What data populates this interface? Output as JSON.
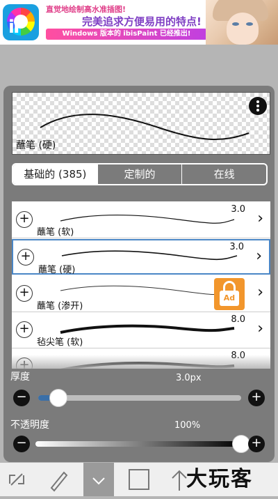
{
  "ad": {
    "line1": "直觉地绘制高水准插图!",
    "line2": "完美追求方便易用的特点!",
    "line3": "Windows 版本的 ibisPaint 已经推出!",
    "logo_text": "iP"
  },
  "preview": {
    "brush_name": "蘸笔 (硬)"
  },
  "tabs": [
    {
      "label": "基础的 (385)",
      "active": true
    },
    {
      "label": "定制的",
      "active": false
    },
    {
      "label": "在线",
      "active": false
    }
  ],
  "brushes": [
    {
      "name": "蘸笔 (软)",
      "size": "3.0",
      "selected": false,
      "locked": false
    },
    {
      "name": "蘸笔 (硬)",
      "size": "3.0",
      "selected": true,
      "locked": false
    },
    {
      "name": "蘸笔 (渗开)",
      "size": "",
      "selected": false,
      "locked": true,
      "lock_label": "Ad"
    },
    {
      "name": "毡尖笔 (软)",
      "size": "8.0",
      "selected": false,
      "locked": false
    },
    {
      "name": "",
      "size": "8.0",
      "selected": false,
      "locked": false
    }
  ],
  "thickness": {
    "label": "厚度",
    "value": "3.0px",
    "level": 0.1
  },
  "opacity": {
    "label": "不透明度",
    "value": "100%",
    "level": 1.0
  },
  "watermark": "大玩客",
  "colors": {
    "selection": "#4a86c6",
    "ad_lock": "#f2962c",
    "slider_fill": "#3a6fa8"
  }
}
